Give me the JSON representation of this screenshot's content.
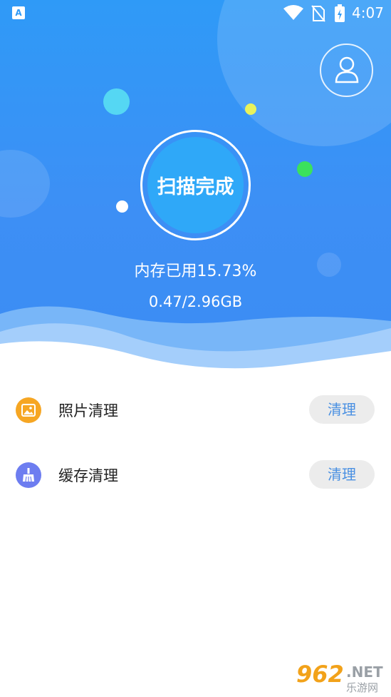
{
  "status_bar": {
    "left_icon_letter": "A",
    "time": "4:07",
    "icons": [
      "app-notification-icon",
      "wifi-icon",
      "no-sim-icon",
      "battery-charging-icon"
    ]
  },
  "header": {
    "profile_icon": "user-icon"
  },
  "scan": {
    "label": "扫描完成",
    "memory_used_text": "内存已用15.73%",
    "memory_used_percent": 15.73,
    "memory_size_text": "0.47/2.96GB"
  },
  "list": {
    "items": [
      {
        "label": "照片清理",
        "icon": "image-icon",
        "button": "清理",
        "icon_color": "#f6a623"
      },
      {
        "label": "缓存清理",
        "icon": "broom-icon",
        "button": "清理",
        "icon_color": "#6d7df0"
      }
    ]
  },
  "watermark": {
    "number": "962",
    "domain": ".NET",
    "chinese": "乐游网"
  },
  "colors": {
    "accent_blue": "#2f9af7",
    "button_text": "#4a90e2",
    "button_bg": "#ececec"
  }
}
